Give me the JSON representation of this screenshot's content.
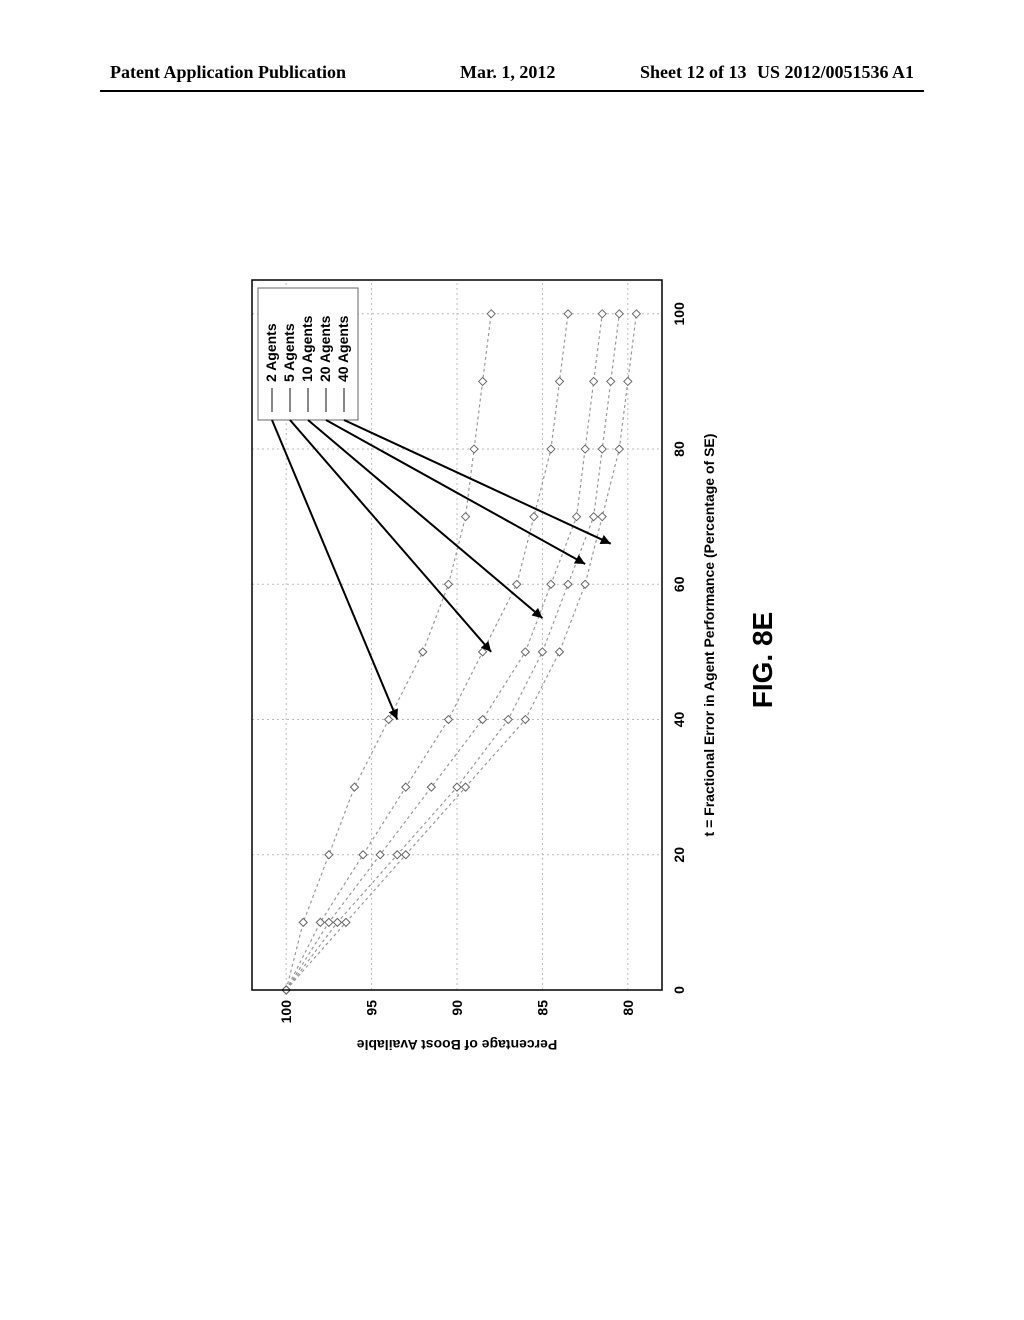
{
  "header": {
    "pub_type": "Patent Application Publication",
    "date": "Mar. 1, 2012",
    "sheet": "Sheet 12 of 13",
    "pub_no": "US 2012/0051536 A1"
  },
  "figure_caption": "FIG. 8E",
  "chart_data": {
    "type": "line",
    "xlabel": "t = Fractional Error in Agent Performance (Percentage of SE)",
    "ylabel": "Percentage of Boost Available",
    "x_ticks": [
      0,
      20,
      40,
      60,
      80,
      100
    ],
    "y_ticks": [
      80,
      85,
      90,
      95,
      100
    ],
    "xlim": [
      0,
      105
    ],
    "ylim": [
      78,
      102
    ],
    "legend_position": "upper-right",
    "series": [
      {
        "name": "2 Agents",
        "x": [
          0,
          10,
          20,
          30,
          40,
          50,
          60,
          70,
          80,
          90,
          100
        ],
        "y": [
          100.0,
          99.0,
          97.5,
          96.0,
          94.0,
          92.0,
          90.5,
          89.5,
          89.0,
          88.5,
          88.0
        ]
      },
      {
        "name": "5 Agents",
        "x": [
          0,
          10,
          20,
          30,
          40,
          50,
          60,
          70,
          80,
          90,
          100
        ],
        "y": [
          100.0,
          98.0,
          95.5,
          93.0,
          90.5,
          88.5,
          86.5,
          85.5,
          84.5,
          84.0,
          83.5
        ]
      },
      {
        "name": "10 Agents",
        "x": [
          0,
          10,
          20,
          30,
          40,
          50,
          60,
          70,
          80,
          90,
          100
        ],
        "y": [
          100.0,
          97.5,
          94.5,
          91.5,
          88.5,
          86.0,
          84.5,
          83.0,
          82.5,
          82.0,
          81.5
        ]
      },
      {
        "name": "20 Agents",
        "x": [
          0,
          10,
          20,
          30,
          40,
          50,
          60,
          70,
          80,
          90,
          100
        ],
        "y": [
          100.0,
          97.0,
          93.5,
          90.0,
          87.0,
          85.0,
          83.5,
          82.0,
          81.5,
          81.0,
          80.5
        ]
      },
      {
        "name": "40 Agents",
        "x": [
          0,
          10,
          20,
          30,
          40,
          50,
          60,
          70,
          80,
          90,
          100
        ],
        "y": [
          100.0,
          96.5,
          93.0,
          89.5,
          86.0,
          84.0,
          82.5,
          81.5,
          80.5,
          80.0,
          79.5
        ]
      }
    ],
    "callouts": [
      {
        "from_series": "2 Agents",
        "to_xy": [
          40,
          93.5
        ]
      },
      {
        "from_series": "5 Agents",
        "to_xy": [
          50,
          88.0
        ]
      },
      {
        "from_series": "10 Agents",
        "to_xy": [
          55,
          85.0
        ]
      },
      {
        "from_series": "20 Agents",
        "to_xy": [
          63,
          82.5
        ]
      },
      {
        "from_series": "40 Agents",
        "to_xy": [
          66,
          81.0
        ]
      }
    ]
  }
}
